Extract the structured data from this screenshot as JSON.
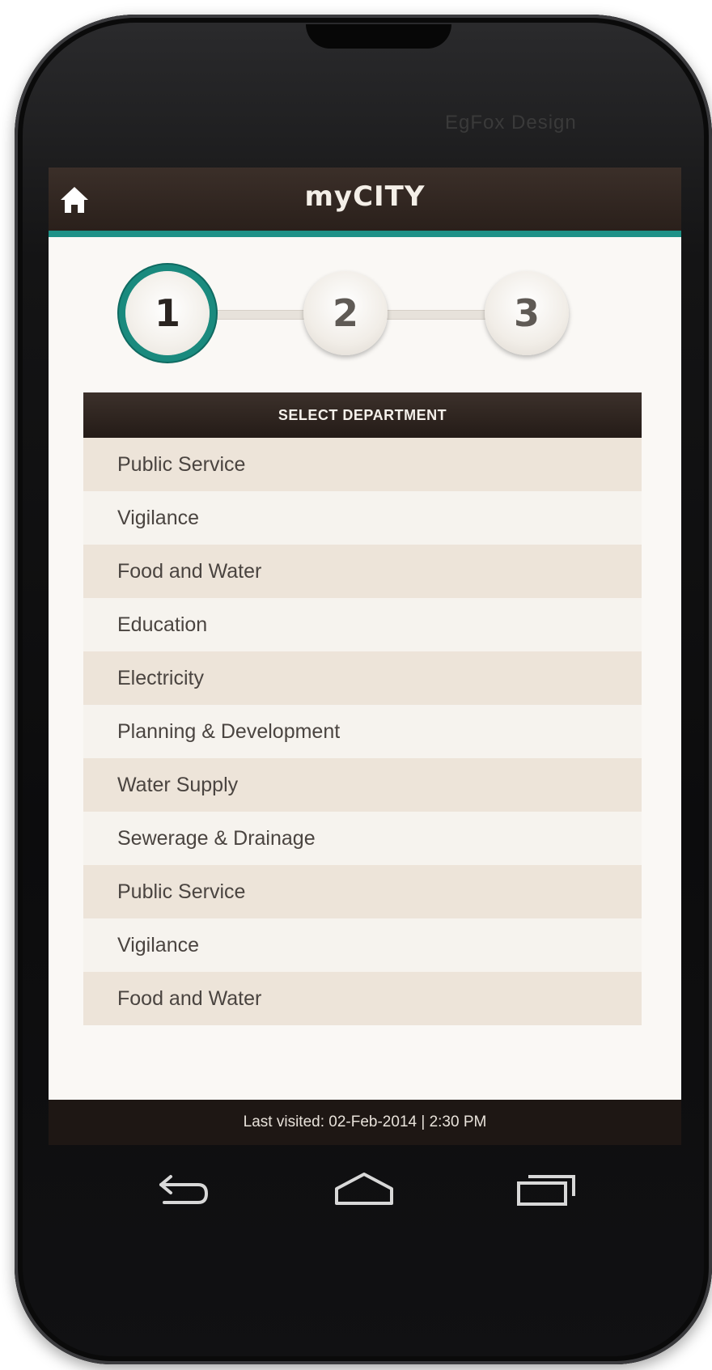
{
  "brand": "EgFox Design",
  "app": {
    "title": "myCITY"
  },
  "steps": [
    "1",
    "2",
    "3"
  ],
  "active_step": 1,
  "departments": {
    "header": "SELECT DEPARTMENT",
    "items": [
      "Public Service",
      "Vigilance",
      "Food and Water",
      "Education",
      "Electricity",
      "Planning & Development",
      "Water Supply",
      "Sewerage & Drainage",
      "Public Service",
      "Vigilance",
      "Food and Water"
    ]
  },
  "footer": {
    "last_visited": "Last visited: 02-Feb-2014 | 2:30 PM"
  },
  "icons": {
    "home": "home-icon",
    "back": "back-icon",
    "home_nav": "home-nav-icon",
    "recents": "recent-apps-icon"
  },
  "colors": {
    "accent": "#1f9187",
    "bar": "#2a201b",
    "row_odd": "#ede4d9",
    "row_even": "#f6f3ee"
  }
}
